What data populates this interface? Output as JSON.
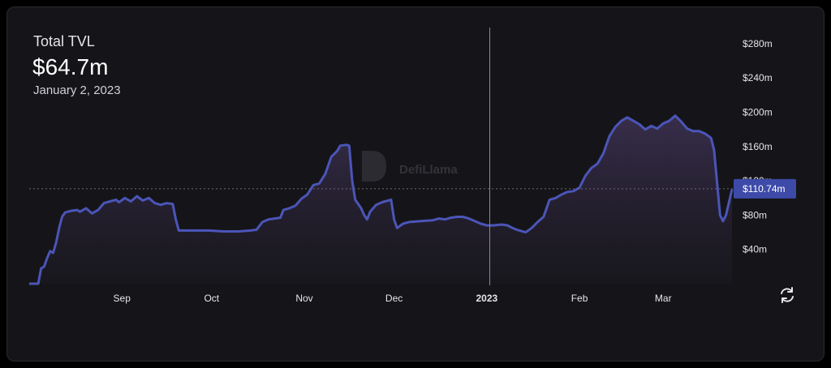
{
  "header": {
    "title": "Total TVL",
    "value": "$64.7m",
    "date": "January 2, 2023"
  },
  "watermark": {
    "text": "DefiLlama"
  },
  "crosshair": {
    "price_label": "$110.74m"
  },
  "colors": {
    "line": "#4b55b8",
    "fill_top": "#3a2f4e",
    "fill_bottom": "#1a1820",
    "label_bg": "#3d4aa8",
    "text": "#e6e6ea"
  },
  "refresh_icon": "refresh-icon",
  "chart_data": {
    "type": "area",
    "title": "Total TVL",
    "ylabel": "",
    "xlabel": "",
    "ylim": [
      0,
      300
    ],
    "y_ticks": [
      40,
      80,
      120,
      160,
      200,
      240,
      280
    ],
    "y_tick_labels": [
      "$40m",
      "$80m",
      "$120m",
      "$160m",
      "$200m",
      "$240m",
      "$280m"
    ],
    "x_ticks": [
      {
        "label": "Sep",
        "date": "2022-09-01"
      },
      {
        "label": "Oct",
        "date": "2022-10-01"
      },
      {
        "label": "Nov",
        "date": "2022-11-01"
      },
      {
        "label": "Dec",
        "date": "2022-12-01"
      },
      {
        "label": "2023",
        "date": "2023-01-01"
      },
      {
        "label": "Feb",
        "date": "2023-02-01"
      },
      {
        "label": "Mar",
        "date": "2023-03-01"
      }
    ],
    "crosshair": {
      "date": "2023-01-02",
      "value": 110.74
    },
    "series": [
      {
        "values": [
          [
            "2022-08-01",
            0
          ],
          [
            "2022-08-04",
            0
          ],
          [
            "2022-08-05",
            18
          ],
          [
            "2022-08-06",
            20
          ],
          [
            "2022-08-07",
            30
          ],
          [
            "2022-08-08",
            38
          ],
          [
            "2022-08-09",
            36
          ],
          [
            "2022-08-10",
            48
          ],
          [
            "2022-08-11",
            65
          ],
          [
            "2022-08-12",
            78
          ],
          [
            "2022-08-13",
            83
          ],
          [
            "2022-08-15",
            85
          ],
          [
            "2022-08-17",
            86
          ],
          [
            "2022-08-18",
            84
          ],
          [
            "2022-08-20",
            88
          ],
          [
            "2022-08-22",
            82
          ],
          [
            "2022-08-24",
            86
          ],
          [
            "2022-08-26",
            94
          ],
          [
            "2022-08-28",
            96
          ],
          [
            "2022-08-30",
            98
          ],
          [
            "2022-08-31",
            95
          ],
          [
            "2022-09-02",
            100
          ],
          [
            "2022-09-04",
            96
          ],
          [
            "2022-09-06",
            102
          ],
          [
            "2022-09-08",
            97
          ],
          [
            "2022-09-10",
            100
          ],
          [
            "2022-09-12",
            94
          ],
          [
            "2022-09-14",
            92
          ],
          [
            "2022-09-16",
            94
          ],
          [
            "2022-09-18",
            93
          ],
          [
            "2022-09-19",
            75
          ],
          [
            "2022-09-20",
            62
          ],
          [
            "2022-09-25",
            62
          ],
          [
            "2022-09-30",
            62
          ],
          [
            "2022-10-05",
            61
          ],
          [
            "2022-10-10",
            61
          ],
          [
            "2022-10-14",
            62
          ],
          [
            "2022-10-16",
            63
          ],
          [
            "2022-10-18",
            72
          ],
          [
            "2022-10-20",
            75
          ],
          [
            "2022-10-22",
            76
          ],
          [
            "2022-10-24",
            77
          ],
          [
            "2022-10-25",
            86
          ],
          [
            "2022-10-27",
            88
          ],
          [
            "2022-10-29",
            91
          ],
          [
            "2022-10-31",
            99
          ],
          [
            "2022-11-02",
            104
          ],
          [
            "2022-11-04",
            115
          ],
          [
            "2022-11-06",
            117
          ],
          [
            "2022-11-08",
            128
          ],
          [
            "2022-11-10",
            148
          ],
          [
            "2022-11-12",
            155
          ],
          [
            "2022-11-13",
            161
          ],
          [
            "2022-11-15",
            162
          ],
          [
            "2022-11-16",
            161
          ],
          [
            "2022-11-17",
            120
          ],
          [
            "2022-11-18",
            98
          ],
          [
            "2022-11-20",
            88
          ],
          [
            "2022-11-21",
            80
          ],
          [
            "2022-11-22",
            75
          ],
          [
            "2022-11-23",
            84
          ],
          [
            "2022-11-25",
            92
          ],
          [
            "2022-11-27",
            95
          ],
          [
            "2022-11-29",
            97
          ],
          [
            "2022-11-30",
            98
          ],
          [
            "2022-12-01",
            75
          ],
          [
            "2022-12-02",
            65
          ],
          [
            "2022-12-04",
            70
          ],
          [
            "2022-12-06",
            72
          ],
          [
            "2022-12-10",
            73
          ],
          [
            "2022-12-14",
            74
          ],
          [
            "2022-12-16",
            76
          ],
          [
            "2022-12-18",
            75
          ],
          [
            "2022-12-20",
            77
          ],
          [
            "2022-12-22",
            78
          ],
          [
            "2022-12-24",
            78
          ],
          [
            "2022-12-26",
            76
          ],
          [
            "2022-12-28",
            73
          ],
          [
            "2022-12-30",
            70
          ],
          [
            "2023-01-01",
            68
          ],
          [
            "2023-01-03",
            68
          ],
          [
            "2023-01-06",
            69
          ],
          [
            "2023-01-08",
            68
          ],
          [
            "2023-01-09",
            66
          ],
          [
            "2023-01-11",
            63
          ],
          [
            "2023-01-14",
            60
          ],
          [
            "2023-01-16",
            65
          ],
          [
            "2023-01-18",
            72
          ],
          [
            "2023-01-20",
            78
          ],
          [
            "2023-01-22",
            98
          ],
          [
            "2023-01-24",
            100
          ],
          [
            "2023-01-26",
            104
          ],
          [
            "2023-01-28",
            107
          ],
          [
            "2023-01-30",
            108
          ],
          [
            "2023-02-01",
            112
          ],
          [
            "2023-02-03",
            126
          ],
          [
            "2023-02-05",
            135
          ],
          [
            "2023-02-07",
            140
          ],
          [
            "2023-02-09",
            152
          ],
          [
            "2023-02-11",
            172
          ],
          [
            "2023-02-13",
            183
          ],
          [
            "2023-02-15",
            190
          ],
          [
            "2023-02-17",
            194
          ],
          [
            "2023-02-19",
            190
          ],
          [
            "2023-02-21",
            186
          ],
          [
            "2023-02-23",
            180
          ],
          [
            "2023-02-25",
            184
          ],
          [
            "2023-02-27",
            181
          ],
          [
            "2023-03-01",
            187
          ],
          [
            "2023-03-03",
            190
          ],
          [
            "2023-03-05",
            196
          ],
          [
            "2023-03-07",
            189
          ],
          [
            "2023-03-09",
            181
          ],
          [
            "2023-03-11",
            178
          ],
          [
            "2023-03-13",
            178
          ],
          [
            "2023-03-15",
            175
          ],
          [
            "2023-03-17",
            170
          ],
          [
            "2023-03-18",
            156
          ],
          [
            "2023-03-19",
            118
          ],
          [
            "2023-03-20",
            80
          ],
          [
            "2023-03-21",
            73
          ],
          [
            "2023-03-22",
            80
          ],
          [
            "2023-03-23",
            95
          ],
          [
            "2023-03-24",
            110
          ]
        ]
      }
    ]
  }
}
